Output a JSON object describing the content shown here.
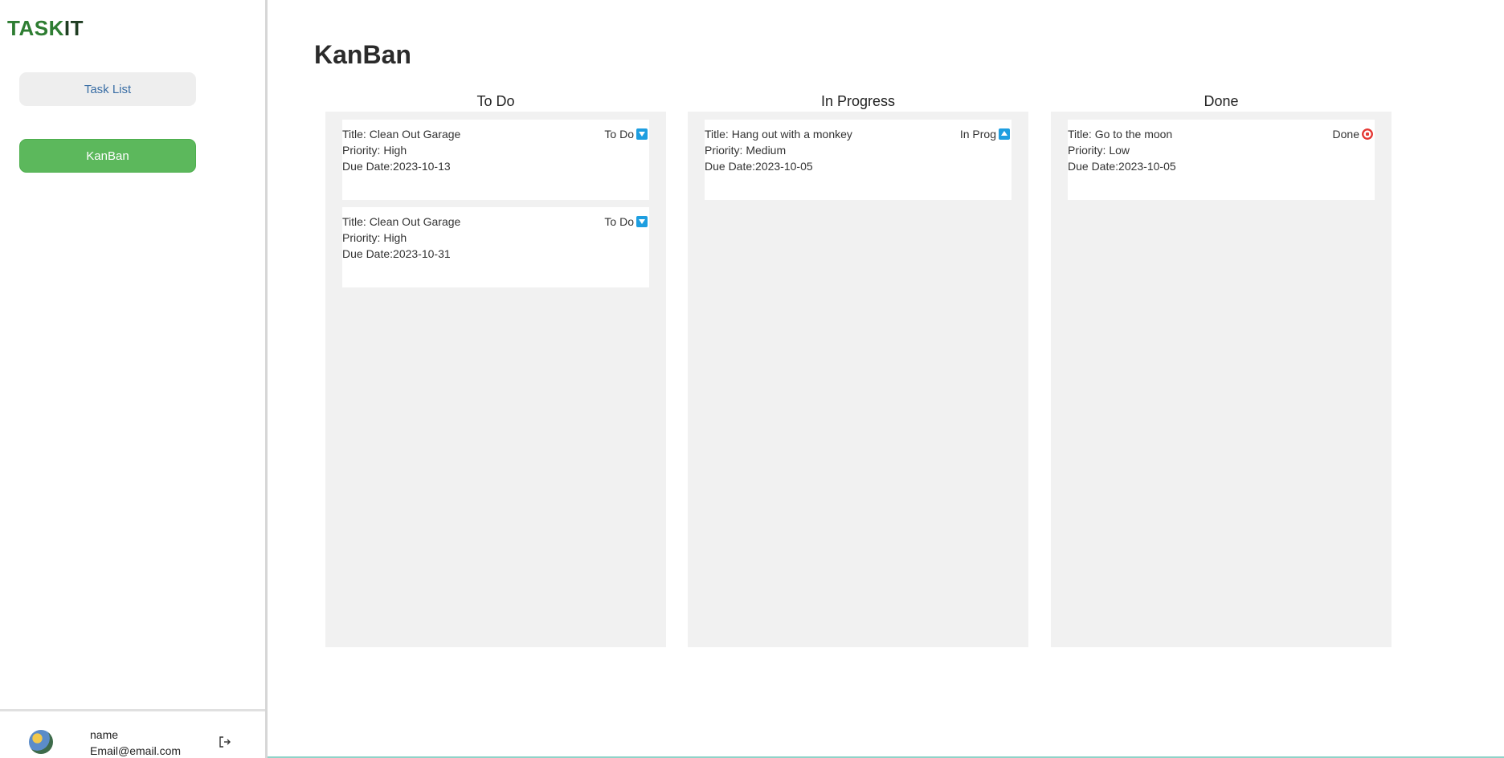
{
  "sidebar": {
    "logo_prefix": "TASK",
    "logo_suffix": "IT",
    "nav": [
      {
        "label": "Task List"
      },
      {
        "label": "KanBan"
      }
    ],
    "user": {
      "name": "name",
      "email": "Email@email.com"
    }
  },
  "page": {
    "title": "KanBan"
  },
  "colors": {
    "accent": "#5cb85c",
    "logo": "#2e7d32",
    "status_icon": "#1e9ee0"
  },
  "columns": [
    {
      "title": "To Do",
      "cards": [
        {
          "title": "Title: Clean Out Garage",
          "priority": "Priority: High",
          "due": "Due Date:2023-10-13",
          "status": "To Do",
          "icon": "arrow-down-icon"
        },
        {
          "title": "Title: Clean Out Garage",
          "priority": "Priority: High",
          "due": "Due Date:2023-10-31",
          "status": "To Do",
          "icon": "arrow-down-icon"
        }
      ]
    },
    {
      "title": "In Progress",
      "cards": [
        {
          "title": "Title: Hang out with a monkey",
          "priority": "Priority: Medium",
          "due": "Due Date:2023-10-05",
          "status": "In Prog",
          "icon": "arrow-up-icon"
        }
      ]
    },
    {
      "title": "Done",
      "cards": [
        {
          "title": "Title: Go to the moon",
          "priority": "Priority: Low",
          "due": "Due Date:2023-10-05",
          "status": "Done",
          "icon": "target-icon"
        }
      ]
    }
  ]
}
